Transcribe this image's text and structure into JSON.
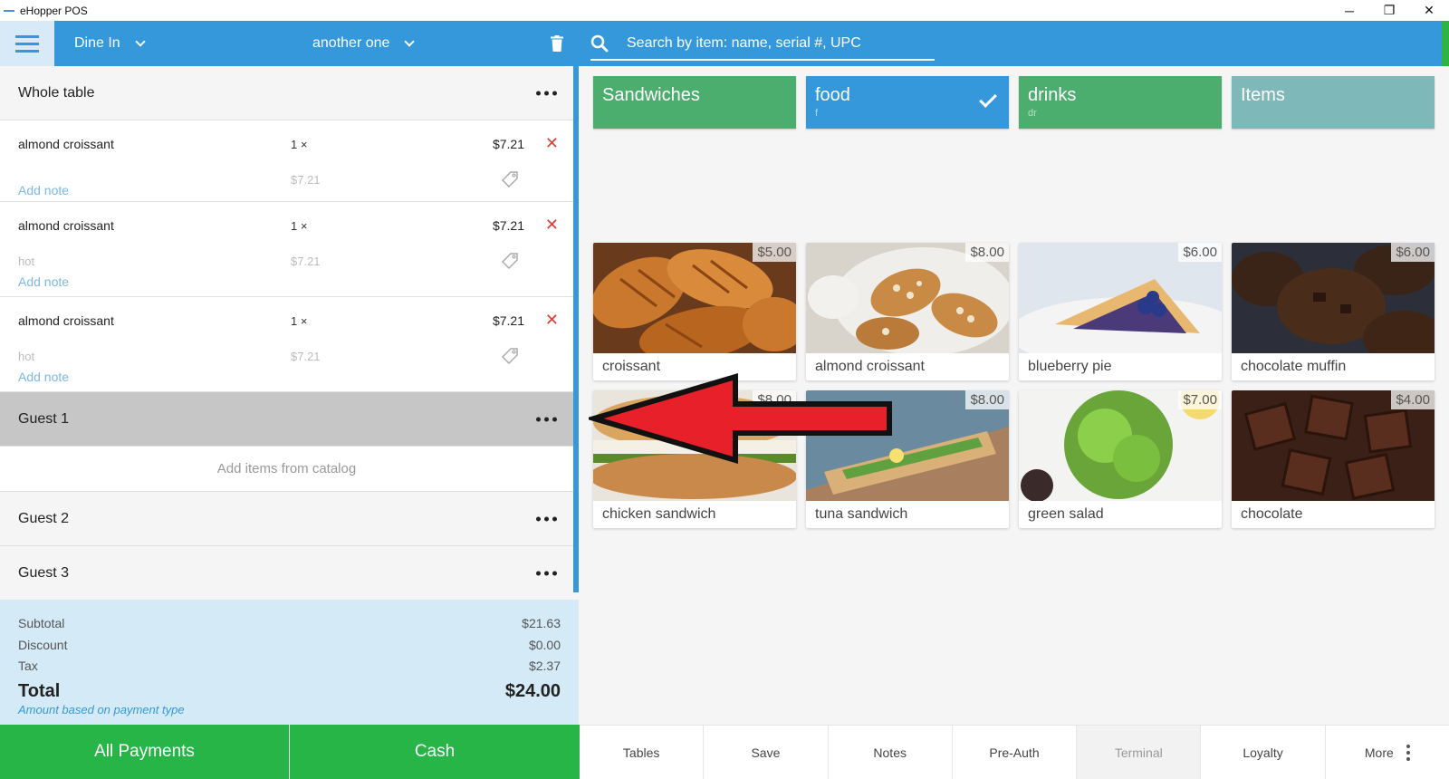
{
  "window": {
    "title": "eHopper POS",
    "minimize": "─",
    "restore": "❐",
    "close": "✕"
  },
  "left_header": {
    "order_type": "Dine In",
    "customer": "another one"
  },
  "search": {
    "placeholder": "Search by item: name, serial #, UPC"
  },
  "order": {
    "whole_table": "Whole table",
    "items": [
      {
        "name": "almond croissant",
        "qty": "1 ×",
        "price": "$7.21",
        "note": "",
        "unit_price": "$7.21",
        "add_note": "Add note"
      },
      {
        "name": "almond croissant",
        "qty": "1 ×",
        "price": "$7.21",
        "note": "hot",
        "unit_price": "$7.21",
        "add_note": "Add note"
      },
      {
        "name": "almond croissant",
        "qty": "1 ×",
        "price": "$7.21",
        "note": "hot",
        "unit_price": "$7.21",
        "add_note": "Add note"
      }
    ],
    "guests": [
      "Guest 1",
      "Guest 2",
      "Guest 3"
    ],
    "add_items_hint": "Add items from catalog"
  },
  "totals": {
    "subtotal_label": "Subtotal",
    "subtotal": "$21.63",
    "discount_label": "Discount",
    "discount": "$0.00",
    "tax_label": "Tax",
    "tax": "$2.37",
    "total_label": "Total",
    "total": "$24.00",
    "note": "Amount based on payment type"
  },
  "payments": {
    "all": "All Payments",
    "cash": "Cash"
  },
  "categories": [
    {
      "name": "Sandwiches",
      "code": "",
      "color": "#4cae6e",
      "selected": false
    },
    {
      "name": "food",
      "code": "f",
      "color": "#3498db",
      "selected": true
    },
    {
      "name": "drinks",
      "code": "dr",
      "color": "#4cae6e",
      "selected": false
    },
    {
      "name": "Items",
      "code": "",
      "color": "#7fb8b8",
      "selected": false
    }
  ],
  "products": [
    {
      "name": "croissant",
      "price": "$5.00"
    },
    {
      "name": "almond croissant",
      "price": "$8.00"
    },
    {
      "name": "blueberry pie",
      "price": "$6.00"
    },
    {
      "name": "chocolate muffin",
      "price": "$6.00"
    },
    {
      "name": "chicken sandwich",
      "price": "$8.00"
    },
    {
      "name": "tuna sandwich",
      "price": "$8.00"
    },
    {
      "name": "green salad",
      "price": "$7.00"
    },
    {
      "name": "chocolate",
      "price": "$4.00"
    }
  ],
  "toolbar": {
    "tables": "Tables",
    "save": "Save",
    "notes": "Notes",
    "preauth": "Pre-Auth",
    "terminal": "Terminal",
    "loyalty": "Loyalty",
    "more": "More"
  }
}
